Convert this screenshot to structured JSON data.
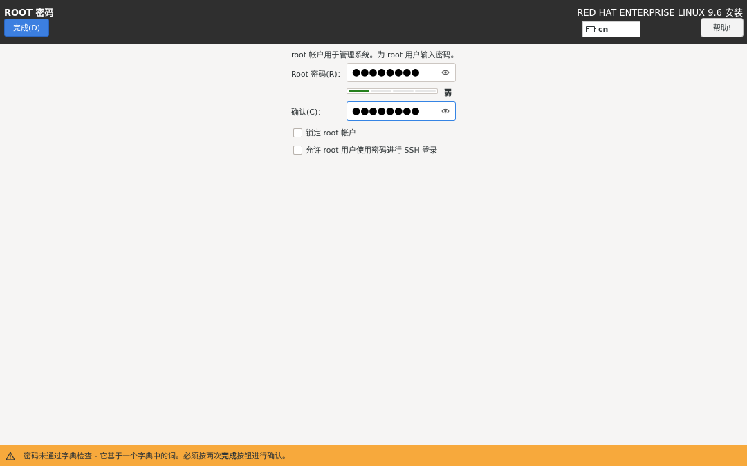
{
  "header": {
    "spoke_title": "ROOT 密码",
    "done_label": "完成(D)",
    "product_title": "RED HAT ENTERPRISE LINUX 9.6 安装",
    "keyboard_layout": "cn",
    "help_label": "帮助!"
  },
  "form": {
    "description": "root 帐户用于管理系统。为 root 用户输入密码。",
    "password_label": "Root 密码(R)：",
    "password_value": "●●●●●●●●",
    "strength_fill_fraction": 0.25,
    "strength_label": "弱",
    "confirm_label": "确认(C)：",
    "confirm_value": "●●●●●●●●",
    "lock_root_label": "锁定 root 帐户",
    "allow_ssh_label": "允许 root 用户使用密码进行 SSH 登录"
  },
  "warning": {
    "before": "密码未通过字典检查 - 它基于一个字典中的词。必须按两次",
    "bold": "完成",
    "after": "按钮进行确认。"
  },
  "colors": {
    "header_bg": "#2f2f2f",
    "done_button": "#3c7fe0",
    "strength_weak": "#26801d",
    "warning_bg": "#f7a93c",
    "focus_border": "#3584e4"
  }
}
